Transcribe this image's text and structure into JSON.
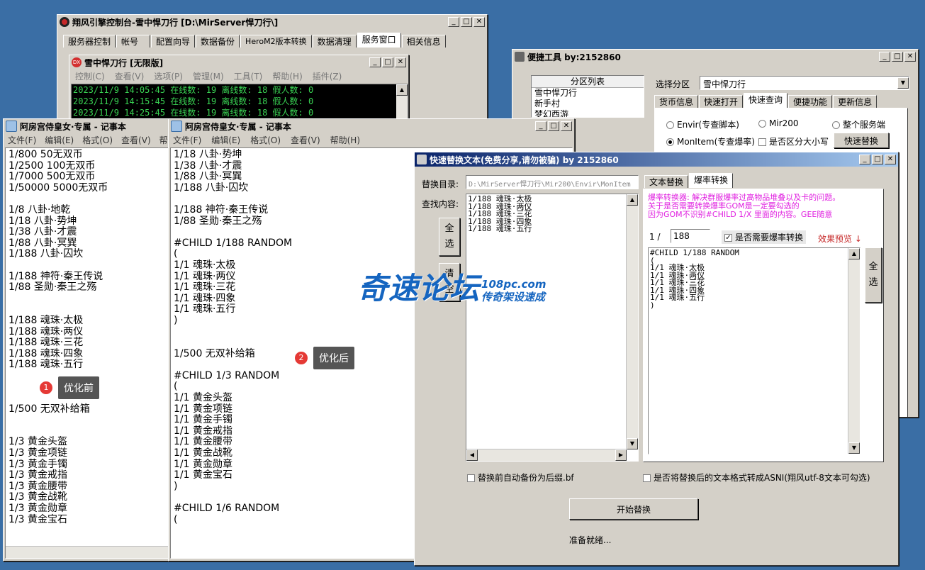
{
  "main_console": {
    "title": "翔风引擎控制台-雪中悍刀行 [D:\\MirServer悍刀行\\]",
    "tabs": [
      "服务器控制",
      "帐号",
      "配置向导",
      "数据备份",
      "HeroM2版本转换",
      "数据清理",
      "服务窗口",
      "相关信息"
    ]
  },
  "inner_server": {
    "title": "雪中悍刀行 [无限版]",
    "menu": [
      "控制(C)",
      "查看(V)",
      "选项(P)",
      "管理(M)",
      "工具(T)",
      "帮助(H)",
      "插件(Z)"
    ],
    "logs": [
      "2023/11/9 14:05:45 在线数: 19 离线数: 18 假人数: 0",
      "2023/11/9 14:15:45 在线数: 19 离线数: 18 假人数: 0",
      "2023/11/9 14:25:45 在线数: 19 离线数: 18 假人数: 0"
    ]
  },
  "shortcut_tool": {
    "title": "便捷工具   by:2152860",
    "partition_list_header": "分区列表",
    "partitions": [
      "雪中悍刀行",
      "新手村",
      "梦幻西游"
    ],
    "select_partition_label": "选择分区",
    "selected_partition": "雪中悍刀行",
    "tabs": [
      "货币信息",
      "快速打开",
      "快速查询",
      "便捷功能",
      "更新信息"
    ],
    "radios": [
      "Envir(专查脚本)",
      "Mir200",
      "整个服务端",
      "MonItem(专查爆率)"
    ],
    "case_checkbox": "是否区分大小写",
    "quick_replace_button": "快速替换"
  },
  "notepad_before": {
    "title": "阿房宫侍皇女·专属 - 记事本",
    "menu": [
      "文件(F)",
      "编辑(E)",
      "格式(O)",
      "查看(V)",
      "帮"
    ],
    "lines": [
      "1/800 50无双币",
      "1/2500 100无双币",
      "1/7000 500无双币",
      "1/50000 5000无双币",
      "",
      "1/8 八卦·地乾",
      "1/18 八卦·势坤",
      "1/38 八卦·才震",
      "1/88 八卦·冥巽",
      "1/188 八卦·囚坎",
      "",
      "1/188 神符·秦王传说",
      "1/88 圣勋·秦王之殇",
      "",
      "",
      "1/188 魂珠·太极",
      "1/188 魂珠·两仪",
      "1/188 魂珠·三花",
      "1/188 魂珠·四象",
      "1/188 魂珠·五行",
      "",
      "",
      "",
      "1/500 无双补给箱",
      "",
      "",
      "1/3 黄金头盔",
      "1/3 黄金项链",
      "1/3 黄金手镯",
      "1/3 黄金戒指",
      "1/3 黄金腰带",
      "1/3 黄金战靴",
      "1/3 黄金勋章",
      "1/3 黄金宝石"
    ],
    "badge_number": "1",
    "badge_text": "优化前"
  },
  "notepad_after": {
    "title": "阿房宫侍皇女·专属 - 记事本",
    "menu": [
      "文件(F)",
      "编辑(E)",
      "格式(O)",
      "查看(V)",
      "帮助(H)"
    ],
    "lines": [
      "1/18 八卦·势坤",
      "1/38 八卦·才震",
      "1/88 八卦·冥巽",
      "1/188 八卦·囚坎",
      "",
      "1/188 神符·秦王传说",
      "1/88 圣勋·秦王之殇",
      "",
      "#CHILD 1/188 RANDOM",
      "(",
      "1/1 魂珠·太极",
      "1/1 魂珠·两仪",
      "1/1 魂珠·三花",
      "1/1 魂珠·四象",
      "1/1 魂珠·五行",
      ")",
      "",
      "",
      "1/500 无双补给箱",
      "",
      "#CHILD 1/3 RANDOM",
      "(",
      "1/1 黄金头盔",
      "1/1 黄金项链",
      "1/1 黄金手镯",
      "1/1 黄金戒指",
      "1/1 黄金腰带",
      "1/1 黄金战靴",
      "1/1 黄金勋章",
      "1/1 黄金宝石",
      ")",
      "",
      "#CHILD 1/6 RANDOM",
      "("
    ],
    "badge_number": "2",
    "badge_text": "优化后"
  },
  "replace_tool": {
    "title": "快速替换文本(免费分享,请勿被骗)     by 2152860",
    "dir_label": "替换目录:",
    "dir_value": "D:\\MirServer悍刀行\\Mir200\\Envir\\MonItem",
    "find_label": "查找内容:",
    "select_all": [
      "全",
      "选"
    ],
    "clear": [
      "清",
      "空"
    ],
    "find_lines": [
      "1/188 魂珠·太极",
      "1/188 魂珠·两仪",
      "1/188 魂珠·三花",
      "1/188 魂珠·四象",
      "1/188 魂珠·五行"
    ],
    "tabs": [
      "文本替换",
      "爆率转换"
    ],
    "info_lines": [
      "爆率转换器: 解决群服爆率过高物品堆叠以及卡的问题。",
      "关于是否需要转换爆率GOM是一定要勾选的",
      "因为GOM不识别#CHILD 1/X 里面的内容。GEE随意"
    ],
    "rate_prefix": "1 /",
    "rate_value": "188",
    "convert_checkbox": "是否需要爆率转换",
    "preview_label": "效果预览 ↓",
    "preview_lines": [
      "#CHILD 1/188 RANDOM",
      "(",
      "1/1 魂珠·太极",
      "1/1 魂珠·两仪",
      "1/1 魂珠·三花",
      "1/1 魂珠·四象",
      "1/1 魂珠·五行",
      ")"
    ],
    "right_select_all": [
      "全",
      "选"
    ],
    "backup_checkbox": "替换前自动备份为后缀.bf",
    "ansi_checkbox": "是否将替换后的文本格式转成ASNI(翔风utf-8文本可勾选)",
    "start_button": "开始替换",
    "status": "准备就绪..."
  },
  "watermark": {
    "main": "奇速论坛",
    "domain": "108pc.com",
    "slogan": "传奇架设速成"
  },
  "colors": {
    "desktop": "#3a6ea5",
    "title_active": "#0a246a",
    "console_text": "#39d353",
    "info_text": "#e020e0",
    "badge_red": "#e53935",
    "watermark_blue": "#1565c0"
  }
}
